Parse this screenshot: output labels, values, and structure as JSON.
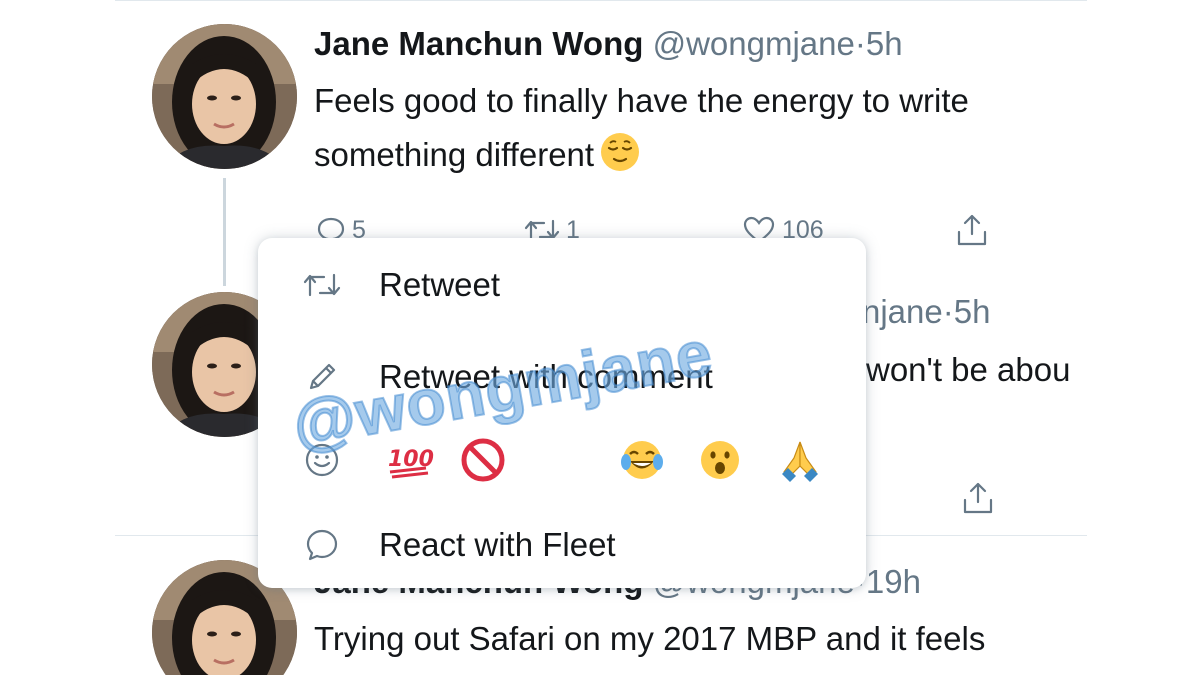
{
  "tweets": [
    {
      "name": "Jane Manchun Wong",
      "handle": "@wongmjane",
      "separator": "·",
      "time": "5h",
      "text_line1": "Feels good to finally have the energy to write",
      "text_line2": "something different",
      "text_emoji": "relieved-face",
      "reply_count": "5",
      "retweet_count": "1",
      "like_count": "106"
    },
    {
      "handle_visible": "njane",
      "separator": "·",
      "time": "5h",
      "text_visible": "won't be abou"
    },
    {
      "name_visible": "Jane Manchun Wong",
      "handle_visible": "@wongmjane",
      "separator": "·",
      "time": "19h",
      "text": "Trying out Safari on my 2017 MBP and it feels"
    }
  ],
  "menu": {
    "items": [
      {
        "label": "Retweet",
        "icon": "retweet-icon"
      },
      {
        "label": "Retweet with comment",
        "icon": "pencil-icon"
      },
      {
        "label": "React with Fleet",
        "icon": "speech-bubble-icon"
      }
    ],
    "reactions_icon": "smiley-icon",
    "reactions": [
      "hundred-points",
      "prohibited",
      "tears-of-joy",
      "surprised-face",
      "folded-hands"
    ]
  },
  "watermark": "@wongmjane",
  "colors": {
    "text": "#14171a",
    "secondary": "#657786",
    "divider": "#e1e8ed",
    "thread_line": "#ccd6dd",
    "watermark": "#6eaae1"
  }
}
